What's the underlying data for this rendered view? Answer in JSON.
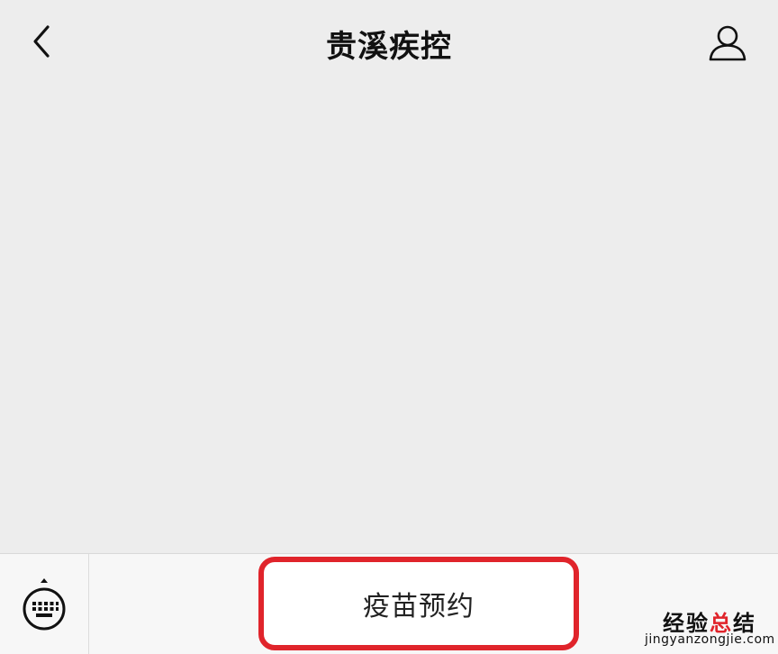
{
  "header": {
    "title": "贵溪疾控",
    "back_icon": "chevron-left-icon",
    "profile_icon": "person-icon"
  },
  "bottom_bar": {
    "keyboard_icon": "keyboard-icon",
    "menu_items": [
      {
        "label": "疫苗预约"
      }
    ],
    "highlight_color": "#e0242b"
  },
  "watermark": {
    "title_black": "经验",
    "title_red": "总",
    "title_black2": "结",
    "url": "jingyanzongjie.com"
  }
}
